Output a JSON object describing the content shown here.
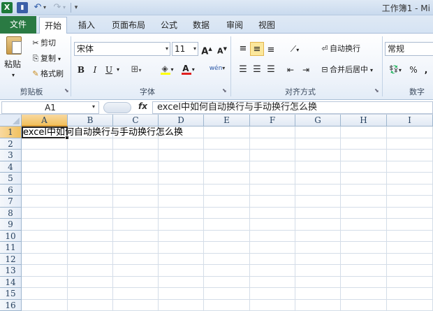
{
  "titlebar": {
    "app_logo": "X",
    "window_title": "工作簿1 - Mi",
    "icons": [
      "excel-logo-icon",
      "save-icon",
      "undo-icon",
      "redo-icon",
      "customize-qat-icon"
    ]
  },
  "tabs": {
    "file": "文件",
    "items": [
      "开始",
      "插入",
      "页面布局",
      "公式",
      "数据",
      "审阅",
      "视图"
    ],
    "active": "开始"
  },
  "ribbon": {
    "clipboard": {
      "paste": "粘贴",
      "cut": "剪切",
      "copy": "复制",
      "format_painter": "格式刷",
      "group_label": "剪贴板"
    },
    "font": {
      "font_name": "宋体",
      "font_size": "11",
      "bold": "B",
      "italic": "I",
      "underline": "U",
      "grow": "A",
      "shrink": "A",
      "font_color": "A",
      "phonetic": "wén",
      "group_label": "字体"
    },
    "alignment": {
      "wrap_text": "自动换行",
      "merge_center": "合并后居中",
      "group_label": "对齐方式"
    },
    "number": {
      "format": "常规",
      "percent": "%",
      "comma": ",",
      "group_label": "数字"
    }
  },
  "formula_bar": {
    "name_box": "A1",
    "fx": "fx",
    "content": "excel中如何自动换行与手动换行怎么换"
  },
  "sheet": {
    "columns": [
      "A",
      "B",
      "C",
      "D",
      "E",
      "F",
      "G",
      "H",
      "I"
    ],
    "rows": [
      "1",
      "2",
      "3",
      "4",
      "5",
      "6",
      "7",
      "8",
      "9",
      "10",
      "11",
      "12",
      "13",
      "14",
      "15",
      "16"
    ],
    "cell_a1": "excel中如何自动换行与手动换行怎么换",
    "selected_cell": "A1"
  },
  "colors": {
    "file_tab": "#2a7a43",
    "selection_header": "#f1c15f",
    "ribbon_bg": "#eef3fa"
  }
}
